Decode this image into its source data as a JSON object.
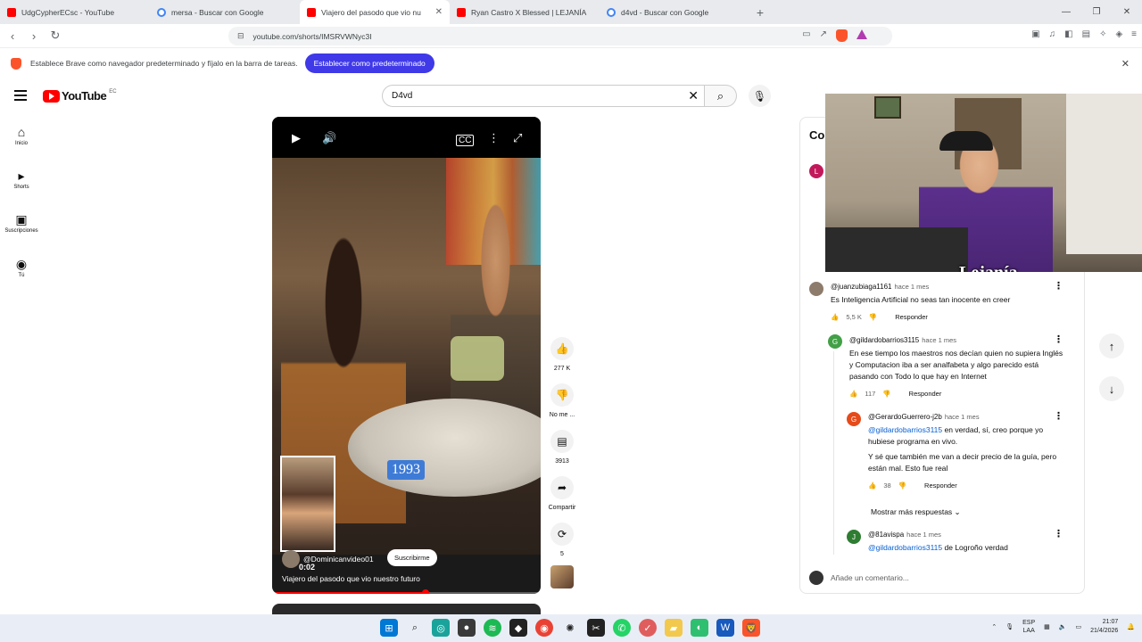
{
  "browser": {
    "tabs": [
      {
        "title": "UdgCypherECsc - YouTube",
        "icon": "youtube-icon",
        "active": false
      },
      {
        "title": "mersa - Buscar con Google",
        "icon": "google-icon",
        "active": false
      },
      {
        "title": "Viajero del pasodo que vio nu",
        "icon": "youtube-icon",
        "active": true
      },
      {
        "title": "Ryan Castro X Blessed | LEJANÍA",
        "icon": "youtube-icon",
        "active": false
      },
      {
        "title": "d4vd - Buscar con Google",
        "icon": "google-icon",
        "active": false
      }
    ],
    "url": "youtube.com/shorts/IMSRVWNyc3I",
    "infobar_text": "Establece Brave como navegador predeterminado y fíjalo en la barra de tareas.",
    "infobar_button": "Establecer como predeterminado"
  },
  "youtube": {
    "logo": "YouTube",
    "country": "EC",
    "search_value": "D4vd",
    "sidebar": [
      {
        "label": "Inicio",
        "icon": "home-icon"
      },
      {
        "label": "Shorts",
        "icon": "shorts-icon"
      },
      {
        "label": "Suscripciones",
        "icon": "subscriptions-icon"
      },
      {
        "label": "Tú",
        "icon": "you-icon"
      }
    ]
  },
  "video": {
    "channel": "@Dominicanvideo01",
    "subscribe": "Suscribirme",
    "time": "0:02",
    "title": "Viajero del pasodo que vio nuestro futuro",
    "year_overlay": "1993",
    "progress": 0.57
  },
  "actions": {
    "likes": "277 K",
    "dislike": "No me ...",
    "comments": "3913",
    "share": "Compartir",
    "remix": "5"
  },
  "comments": {
    "title": "Comentarios",
    "my_initial": "L",
    "items": [
      {
        "author": "@juanzubiaga1161",
        "ago": "hace 1 mes",
        "text": "Es Inteligencia Artificial no seas tan inocente en creer",
        "likes": "5,5 K",
        "reply": "Responder",
        "avatar_color": "#8d7b6c",
        "initial": ""
      },
      {
        "author": "@gildardobarrios3115",
        "ago": "hace 1 mes",
        "text": "En ese tiempo los maestros nos decían quien no supiera Inglés y Computacion iba a ser analfabeta y algo parecido está pasando con Todo lo que hay en Internet",
        "likes": "117",
        "reply": "Responder",
        "avatar_color": "#43a047",
        "initial": "G"
      },
      {
        "author": "@GerardoGuerrero-j2b",
        "ago": "hace 1 mes",
        "mention": "@gildardobarrios3115",
        "text": " en verdad, sí, creo porque yo hubiese programa en vivo.",
        "text2": "Y sé que también me van a decir precio de la guía, pero están mal. Esto fue real",
        "likes": "38",
        "reply": "Responder",
        "avatar_color": "#e64a19",
        "initial": "G"
      },
      {
        "author": "@81avispa",
        "ago": "hace 1 mes",
        "mention": "@gildardobarrios3115",
        "text": " de Logroño verdad",
        "avatar_color": "#2e7d32",
        "initial": "J"
      }
    ],
    "more_replies": "Mostrar más respuestas",
    "add_placeholder": "Añade un comentario..."
  },
  "webcam": {
    "watermark": "Lejanía"
  },
  "taskbar": {
    "lang1": "ESP",
    "lang2": "LAA",
    "time": "21:07",
    "date": "21/4/2026"
  }
}
